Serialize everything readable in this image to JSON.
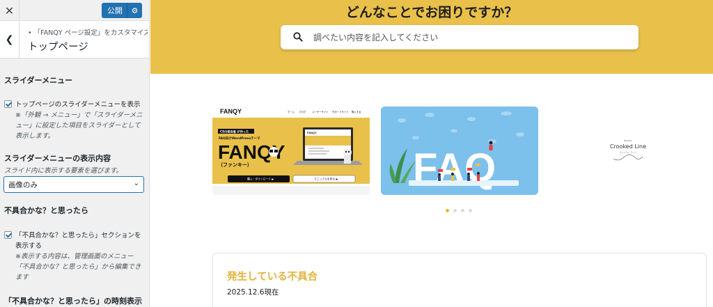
{
  "topbar": {
    "close_icon": "close-icon",
    "publish_label": "公開",
    "settings_icon": "gear-icon"
  },
  "section": {
    "breadcrumb": "「FANQY ページ設定」をカスタマイズ中",
    "title": "トップページ"
  },
  "controls": {
    "slider_heading": "スライダーメニュー",
    "slider_checkbox_label": "トップページのスライダーメニューを表示",
    "slider_checkbox_checked": true,
    "slider_note": "※「外観 → メニュー」で「スライダーメニュー」に設定した項目をスライダーとして表示します。",
    "slider_content_heading": "スライダーメニューの表示内容",
    "slider_content_desc": "スライド内に表示する要素を選びます。",
    "slider_content_value": "画像のみ",
    "trouble_heading": "不具合かな？と思ったら",
    "trouble_checkbox_label": "「不具合かな？と思ったら」セクションを表示する",
    "trouble_checkbox_checked": true,
    "trouble_note": "※表示する内容は、管理画面のメニュー「不具合かな？と思ったら」から編集できます",
    "trouble_time_heading": "「不具合かな？と思ったら」の時刻表示"
  },
  "preview": {
    "hero_title": "どんなことでお困りですか？",
    "search_placeholder": "調べたい内容を記入してください",
    "colors": {
      "hero": "#e9c04a",
      "accent": "#e3b43b",
      "sky": "#7cc0ec"
    },
    "slides": [
      {
        "brand": "FANQY",
        "nav": [
          "ホーム",
          "ブログ",
          "ユーザーサイト",
          "サポートサイト",
          "購入する"
        ],
        "tagline1": "CSの担当者 が作った",
        "tagline2": "FAQ向けWordPressテーマ",
        "logo": "FANQY",
        "kana": "（ファンキー）",
        "btn1": "購入・ダウンロード ▶",
        "btn2": "マニュアルを見る ▶",
        "mock_logo": "FANQY"
      },
      {
        "text": "FAQ"
      },
      {
        "small": "Blodian",
        "name": "Crooked Line",
        "sub": "クルックド ライン"
      }
    ],
    "dots_active": 0,
    "dots_total": 4,
    "issue_title": "発生している不具合",
    "issue_date": "2025.12.6現在"
  }
}
